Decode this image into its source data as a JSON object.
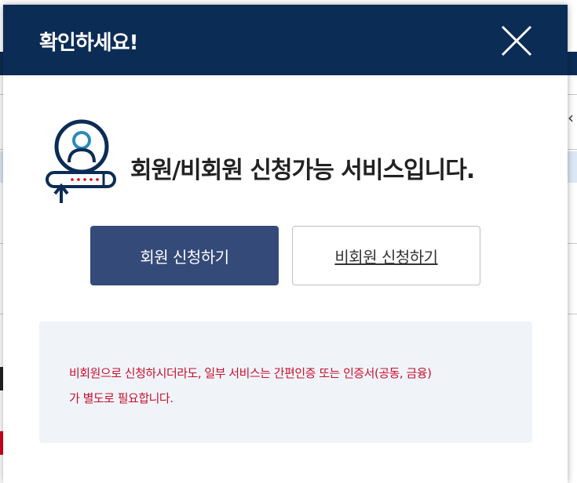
{
  "modal": {
    "title": "확인하세요!",
    "close_icon": "close-icon",
    "headline": "회원/비회원 신청가능 서비스입니다.",
    "illustration_icon": "user-login-icon",
    "buttons": {
      "member_label": "회원 신청하기",
      "guest_label": "비회원 신청하기"
    },
    "notice": {
      "line1": "비회원으로 신청하시더라도, 일부 서비스는 간편인증 또는 인증서(공동, 금융)",
      "line2": "가 별도로 필요합니다."
    }
  },
  "colors": {
    "header_bg": "#0b2c55",
    "primary_button": "#344a79",
    "notice_bg": "#f0f4f9",
    "notice_text": "#c8102e"
  }
}
